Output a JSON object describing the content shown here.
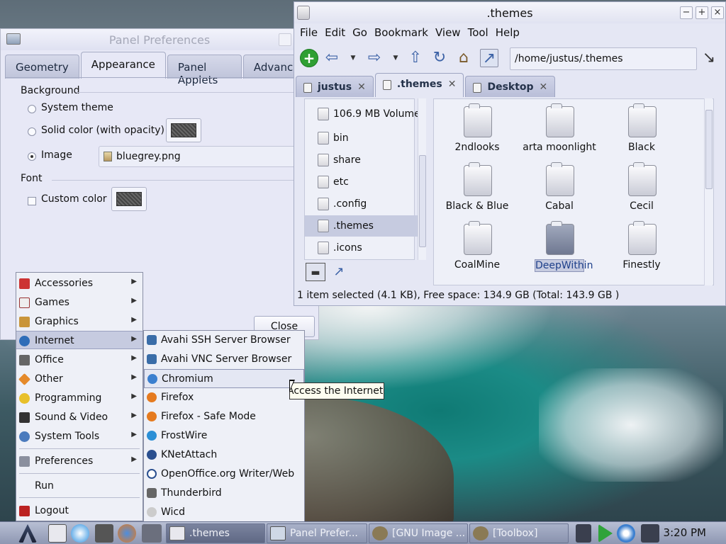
{
  "panel_prefs": {
    "title": "Panel Preferences",
    "tabs": [
      "Geometry",
      "Appearance",
      "Panel Applets",
      "Advanced"
    ],
    "active_tab": "Appearance",
    "background_label": "Background",
    "options": [
      "System theme",
      "Solid color (with opacity)",
      "Image"
    ],
    "selected_option": "Image",
    "image_file": "bluegrey.png",
    "font_label": "Font",
    "custom_color_label": "Custom color",
    "close_label": "Close"
  },
  "file_manager": {
    "title": ".themes",
    "menu": [
      "File",
      "Edit",
      "Go",
      "Bookmark",
      "View",
      "Tool",
      "Help"
    ],
    "path": "/home/justus/.themes",
    "tabs": [
      "justus",
      ".themes",
      "Desktop"
    ],
    "active_tab": ".themes",
    "sidebar": [
      "106.9 MB Volume",
      "bin",
      "share",
      "etc",
      ".config",
      ".themes",
      ".icons"
    ],
    "sidebar_selected": ".themes",
    "folders": [
      "2ndlooks",
      "arta moonlight",
      "Black",
      "Black & Blue",
      "Cabal",
      "Cecil",
      "CoalMine",
      "DeepWithin",
      "Finestly"
    ],
    "selected_folder": "DeepWithin",
    "status": "1 item selected (4.1 KB), Free space: 134.9 GB (Total: 143.9 GB )"
  },
  "app_menu": {
    "items": [
      "Accessories",
      "Games",
      "Graphics",
      "Internet",
      "Office",
      "Other",
      "Programming",
      "Sound & Video",
      "System Tools",
      "Preferences",
      "Run",
      "Logout"
    ],
    "highlighted": "Internet",
    "internet_items": [
      "Avahi SSH Server Browser",
      "Avahi VNC Server Browser",
      "Chromium",
      "Firefox",
      "Firefox - Safe Mode",
      "FrostWire",
      "KNetAttach",
      "OpenOffice.org Writer/Web",
      "Thunderbird",
      "Wicd"
    ],
    "internet_highlighted": "Chromium",
    "tooltip": "Access the Internet"
  },
  "taskbar": {
    "tasks": [
      ".themes",
      "Panel Prefer...",
      "[GNU Image ...",
      "[Toolbox]"
    ],
    "active_task": ".themes",
    "clock": "3:20 PM"
  },
  "colors": {
    "window_bg": "#e7e8f6",
    "selection": "#c6cbe0",
    "taskbar": "#9aa2bd"
  }
}
